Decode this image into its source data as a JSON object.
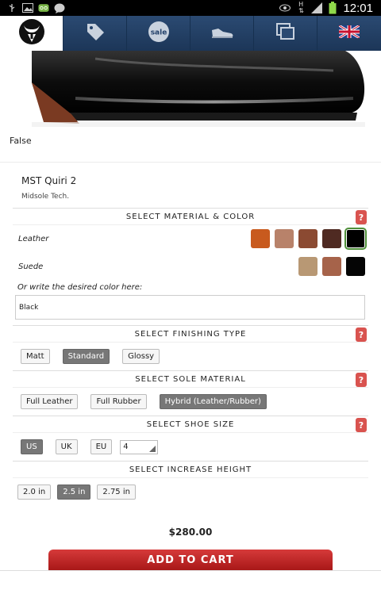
{
  "status_bar": {
    "time": "12:01",
    "icons": [
      "usb-icon",
      "gallery-icon",
      "voicemail-icon",
      "chat-icon",
      "eye-icon",
      "hspa-icon",
      "signal-icon",
      "battery-icon"
    ]
  },
  "nav": {
    "items": [
      "logo-icon",
      "tag-icon",
      "sale-icon",
      "shoe-icon",
      "gallery-icon",
      "uk-flag-icon"
    ],
    "sale_text": "sale"
  },
  "product": {
    "image_caption": "False",
    "name": "MST Quiri 2",
    "subtitle": "Midsole Tech."
  },
  "material_color": {
    "title": "SELECT MATERIAL & COLOR",
    "leather_label": "Leather",
    "leather_colors": [
      "#c85a1e",
      "#b8826a",
      "#8b4a32",
      "#4f2a22",
      "#000000"
    ],
    "suede_label": "Suede",
    "suede_colors": [
      "#b89874",
      "#a6634a",
      "#050505"
    ],
    "write_label": "Or write the desired color here:",
    "color_value": "Black"
  },
  "finishing": {
    "title": "SELECT FINISHING TYPE",
    "options": [
      "Matt",
      "Standard",
      "Glossy"
    ],
    "selected": "Standard"
  },
  "sole": {
    "title": "SELECT SOLE MATERIAL",
    "options": [
      "Full Leather",
      "Full Rubber",
      "Hybrid (Leather/Rubber)"
    ],
    "selected": "Hybrid (Leather/Rubber)"
  },
  "size": {
    "title": "SELECT SHOE SIZE",
    "systems": [
      "US",
      "UK",
      "EU"
    ],
    "selected_system": "US",
    "value": "4"
  },
  "height": {
    "title": "SELECT INCREASE HEIGHT",
    "options": [
      "2.0 in",
      "2.5 in",
      "2.75 in"
    ],
    "selected": "2.5 in"
  },
  "help_label": "?",
  "price": "$280.00",
  "add_to_cart": "ADD TO CART"
}
